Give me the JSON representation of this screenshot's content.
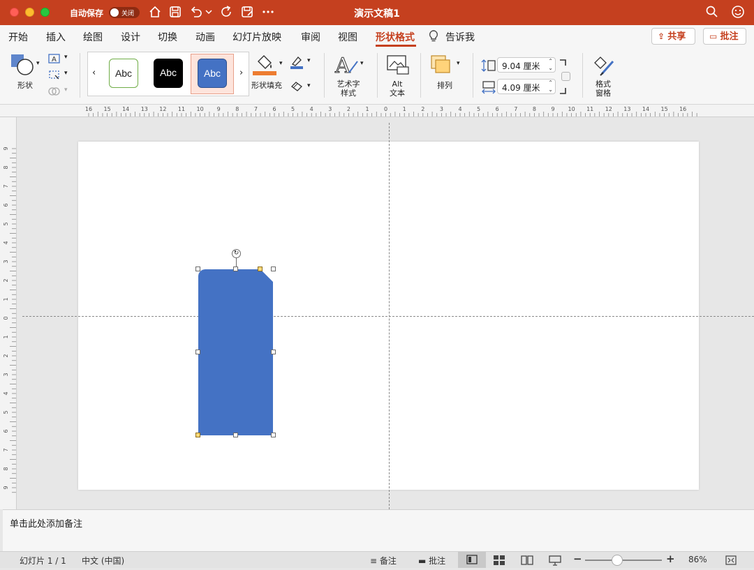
{
  "window": {
    "autosave_label": "自动保存",
    "autosave_state": "关闭",
    "doc_title": "演示文稿1"
  },
  "tabs": [
    "开始",
    "插入",
    "绘图",
    "设计",
    "切换",
    "动画",
    "幻灯片放映",
    "审阅",
    "视图",
    "形状格式"
  ],
  "tell_me": "告诉我",
  "header_buttons": {
    "share": "共享",
    "comment": "批注"
  },
  "ribbon": {
    "shape_label": "形状",
    "style_swatch_text": "Abc",
    "fill_label": "形状填充",
    "wordart_label_line1": "艺术字",
    "wordart_label_line2": "样式",
    "alt_label_line1": "Alt",
    "alt_label_line2": "文本",
    "arrange_label": "排列",
    "height_value": "9.04 厘米",
    "width_value": "4.09 厘米",
    "format_pane_line1": "格式",
    "format_pane_line2": "窗格",
    "fill_color": "#ed7d31",
    "line_color": "#4472c4"
  },
  "ruler_top_labels": [
    "16",
    "15",
    "14",
    "13",
    "12",
    "11",
    "10",
    "9",
    "8",
    "7",
    "6",
    "5",
    "4",
    "3",
    "2",
    "1",
    "0",
    "1",
    "2",
    "3",
    "4",
    "5",
    "6",
    "7",
    "8",
    "9",
    "10",
    "11",
    "12",
    "13",
    "14",
    "15",
    "16"
  ],
  "ruler_left_labels": [
    "9",
    "8",
    "7",
    "6",
    "5",
    "4",
    "3",
    "2",
    "1",
    "0",
    "1",
    "2",
    "3",
    "4",
    "5",
    "6",
    "7",
    "8",
    "9"
  ],
  "shape": {
    "fill": "#4472c4",
    "type": "snip-round-rectangle"
  },
  "notes_placeholder": "单击此处添加备注",
  "status": {
    "slide_info": "幻灯片 1 / 1",
    "language": "中文 (中国)",
    "notes": "备注",
    "comments": "批注",
    "zoom": "86%"
  },
  "accent": "#c5401f"
}
